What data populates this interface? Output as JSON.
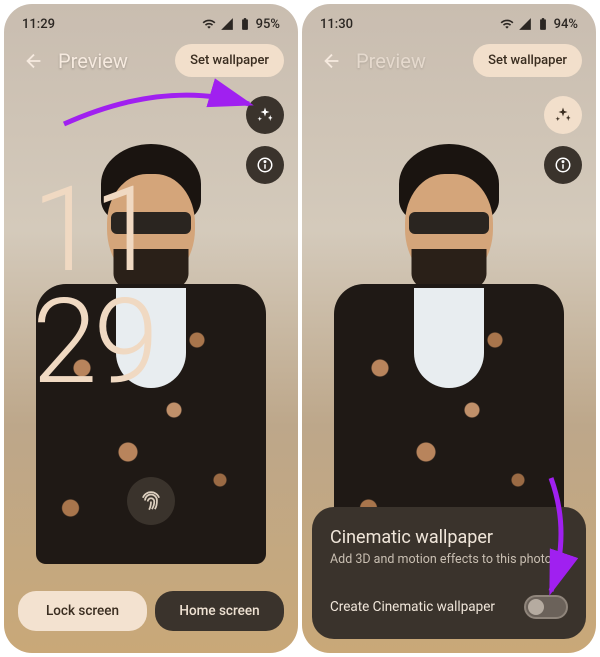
{
  "left": {
    "status": {
      "time": "11:29",
      "battery": "95%"
    },
    "header": {
      "title": "Preview",
      "set_label": "Set wallpaper"
    },
    "icons": {
      "sparkle": "sparkle-icon",
      "info": "info-icon"
    },
    "clock": {
      "h": "11",
      "m": "29"
    },
    "tabs": {
      "lock": "Lock screen",
      "home": "Home screen"
    }
  },
  "right": {
    "status": {
      "time": "11:30",
      "battery": "94%"
    },
    "header": {
      "title": "Preview",
      "set_label": "Set wallpaper"
    },
    "icons": {
      "sparkle": "sparkle-icon",
      "info": "info-icon"
    },
    "sheet": {
      "title": "Cinematic wallpaper",
      "sub": "Add 3D and motion effects to this photo",
      "row_label": "Create Cinematic wallpaper",
      "toggle_on": false
    }
  },
  "colors": {
    "accent": "#f2dfcb",
    "dark": "#3a332c",
    "arrow": "#a020f0"
  }
}
